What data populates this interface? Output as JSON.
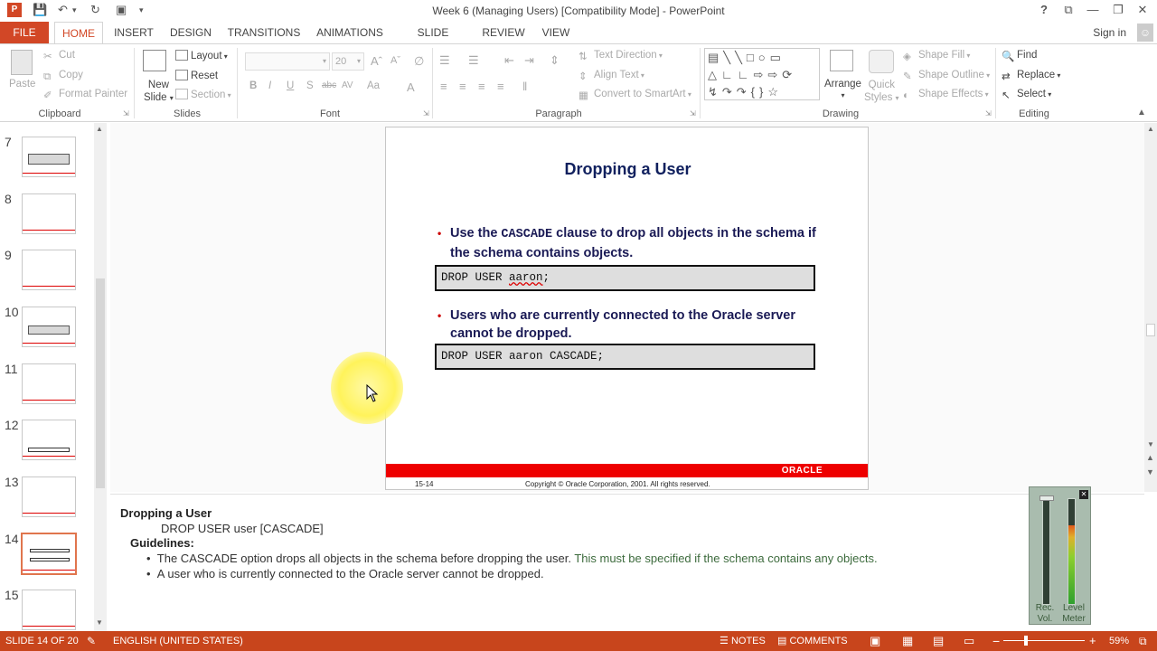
{
  "window": {
    "title": "Week 6 (Managing Users) [Compatibility Mode] - PowerPoint",
    "help": "?"
  },
  "tabs": {
    "file": "FILE",
    "items": [
      "HOME",
      "INSERT",
      "DESIGN",
      "TRANSITIONS",
      "ANIMATIONS",
      "SLIDE SHOW",
      "REVIEW",
      "VIEW"
    ],
    "active": "HOME",
    "signin": "Sign in"
  },
  "ribbon": {
    "clipboard": {
      "label": "Clipboard",
      "paste": "Paste",
      "cut": "Cut",
      "copy": "Copy",
      "format_painter": "Format Painter"
    },
    "slides": {
      "label": "Slides",
      "new_slide_1": "New",
      "new_slide_2": "Slide",
      "layout": "Layout",
      "reset": "Reset",
      "section": "Section"
    },
    "font": {
      "label": "Font",
      "size": "20",
      "bold": "B",
      "italic": "I",
      "underline": "U",
      "shadow": "S",
      "strike": "abc",
      "spacing": "AV",
      "case": "Aa",
      "color": "A"
    },
    "paragraph": {
      "label": "Paragraph",
      "text_direction": "Text Direction",
      "align_text": "Align Text",
      "convert_smartart": "Convert to SmartArt"
    },
    "drawing": {
      "label": "Drawing",
      "arrange": "Arrange",
      "quick_styles_1": "Quick",
      "quick_styles_2": "Styles",
      "shape_fill": "Shape Fill",
      "shape_outline": "Shape Outline",
      "shape_effects": "Shape Effects"
    },
    "editing": {
      "label": "Editing",
      "find": "Find",
      "replace": "Replace",
      "select": "Select"
    }
  },
  "thumbnails": [
    {
      "num": "7"
    },
    {
      "num": "8"
    },
    {
      "num": "9"
    },
    {
      "num": "10"
    },
    {
      "num": "11"
    },
    {
      "num": "12"
    },
    {
      "num": "13"
    },
    {
      "num": "14",
      "selected": true
    },
    {
      "num": "15"
    }
  ],
  "slide": {
    "title": "Dropping a User",
    "bullet1_pre": "Use the ",
    "bullet1_code": "CASCADE",
    "bullet1_post": " clause to drop all objects in the schema if the schema contains objects.",
    "code1_pre": "DROP USER ",
    "code1_word": "aaron",
    "code1_post": ";",
    "bullet2": "Users who are currently connected to the Oracle server cannot be dropped.",
    "code2": "DROP USER aaron CASCADE;",
    "logo": "ORACLE",
    "page": "15-14",
    "copyright": "Copyright © Oracle Corporation, 2001. All rights reserved."
  },
  "notes": {
    "title": "Dropping a User",
    "syntax": "DROP USER user [CASCADE]",
    "guidelines": "Guidelines:",
    "item1_a": "The CASCADE option drops all objects in the schema before dropping the user. ",
    "item1_b": "This must be specified if the schema contains any objects.",
    "item2": "A user who is currently connected to the Oracle server cannot be dropped."
  },
  "meter": {
    "label1_a": "Rec.",
    "label1_b": "Vol.",
    "label2_a": "Level",
    "label2_b": "Meter",
    "level": 0.75
  },
  "status": {
    "slide": "SLIDE 14 OF 20",
    "language": "ENGLISH (UNITED STATES)",
    "notes": "NOTES",
    "comments": "COMMENTS",
    "zoom": "59%"
  },
  "colors": {
    "accent": "#d24726",
    "status_bar": "#c8451c",
    "slide_title": "#10205e",
    "oracle_red": "#e00000"
  }
}
